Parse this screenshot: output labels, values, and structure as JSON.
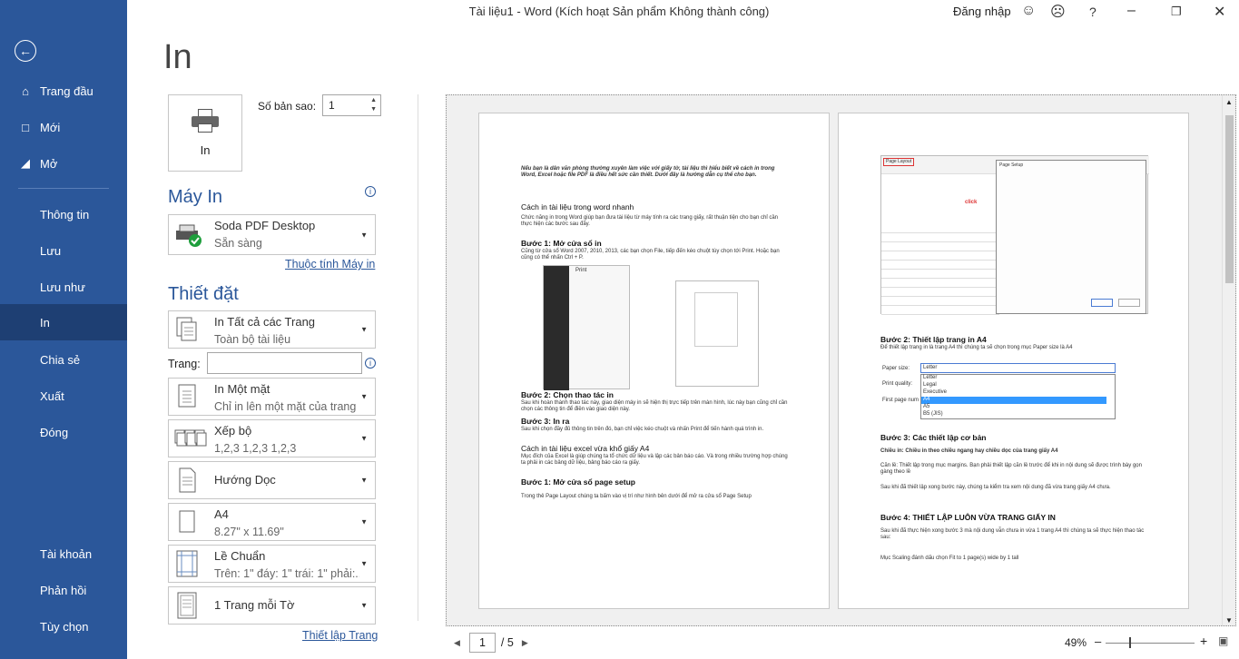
{
  "window": {
    "title": "Tài liệu1  -  Word (Kích hoạt Sản phẩm Không thành công)",
    "signin": "Đăng nhập"
  },
  "sidebar": {
    "items": [
      {
        "label": "Trang đầu",
        "icon": "home-icon"
      },
      {
        "label": "Mới",
        "icon": "new-document-icon"
      },
      {
        "label": "Mở",
        "icon": "folder-open-icon"
      },
      {
        "label": "Thông tin"
      },
      {
        "label": "Lưu"
      },
      {
        "label": "Lưu như"
      },
      {
        "label": "In",
        "active": true
      },
      {
        "label": "Chia sẻ"
      },
      {
        "label": "Xuất"
      },
      {
        "label": "Đóng"
      },
      {
        "label": "Tài khoản"
      },
      {
        "label": "Phản hồi"
      },
      {
        "label": "Tùy chọn"
      }
    ]
  },
  "main": {
    "heading": "In",
    "print_button": "In",
    "copies_label": "Số bản sao:",
    "copies_value": "1",
    "printer_section": "Máy In",
    "printer_name": "Soda PDF Desktop",
    "printer_status": "Sẵn sàng",
    "printer_properties": "Thuộc tính Máy in",
    "settings_section": "Thiết đặt",
    "settings": [
      {
        "l1": "In Tất cả các Trang",
        "l2": "Toàn bộ tài liệu"
      },
      {
        "l1": "In Một mặt",
        "l2": "Chỉ in lên một mặt của trang"
      },
      {
        "l1": "Xếp bộ",
        "l2": "1,2,3    1,2,3    1,2,3"
      },
      {
        "l1": "Hướng Dọc",
        "l2": ""
      },
      {
        "l1": "A4",
        "l2": "8.27\" x 11.69\""
      },
      {
        "l1": "Lề Chuẩn",
        "l2": "Trên: 1\" đáy: 1\" trái: 1\" phải:..."
      },
      {
        "l1": "1 Trang mỗi Tờ",
        "l2": ""
      }
    ],
    "pages_label": "Trang:",
    "page_setup_link": "Thiết lập Trang"
  },
  "preview": {
    "page1": {
      "intro": "Nếu bạn là dân văn phòng thường xuyên làm việc với giấy tờ, tài liệu thì hiểu biết về cách in trong Word, Excel  hoặc file PDF là điều hết sức cần thiết. Dưới đây là hướng dẫn cụ thể cho bạn.",
      "h1": "Cách in tài liệu trong word nhanh",
      "p1": "Chức năng in trong Word giúp bạn đưa tài liệu từ máy tính ra các trang giấy, rất thuận tiện cho bạn chỉ cần thực hiện các bước sau đây.",
      "b1": "Bước 1: Mở cửa sổ in",
      "p2": "Cũng từ cửa sổ Word 2007, 2010, 2013, các bạn chọn File, tiếp đến kéo chuột tùy chọn tới Print. Hoặc bạn cũng có thể nhấn Ctrl + P.",
      "b2": "Bước 2: Chọn thao tác in",
      "p3": "Sau khi hoàn thành thao tác này, giao diện máy in sẽ hiện thị trực tiếp trên màn hình, lúc này bạn cũng chỉ cần chọn các thông tin để điền vào giao diện này.",
      "b3": "Bước 3: In ra",
      "p4": "Sau khi chọn đầy đủ thông tin trên đó, bạn chỉ việc kéo chuột và nhấn Print để tiến hành quá trình in.",
      "h2": "Cách in tài liệu excel vừa khổ giấy A4",
      "p5": "Mục đích của Excel là giúp chúng ta tổ chức dữ liệu và lập các bản báo cáo. Và trong nhiều trường hợp chúng ta phải in các bảng dữ liệu, bảng báo cáo ra giấy.",
      "b4": "Bước 1: Mở cửa sổ page setup",
      "p6": "Trong thẻ Page Layout chúng ta bấm vào vị trí như hình bên dưới để mở ra cửa sổ Page Setup",
      "thumb_label": "Print"
    },
    "page2": {
      "b1": "Bước 2: Thiết lập trang in A4",
      "p1": "Để thiết lập trang in là trang A4 thì chúng ta sẽ chọn trong mục Paper size là A4",
      "paper_size_label": "Paper size:",
      "print_quality_label": "Print quality:",
      "first_page_label": "First page num",
      "paper_options": [
        "Letter",
        "Legal",
        "Executive",
        "A4",
        "A5",
        "B5 (JIS)"
      ],
      "paper_selected": "Letter",
      "b2": "Bước 3: Các thiết lập cơ bản",
      "p2": "Chiều in: Chiều in theo chiều ngang hay chiều dọc của trang giấy A4",
      "p3": "Căn lề: Thiết lập trong mục margins. Bạn phải thiết lập căn lề trước để khi in nội dung sẽ được trình bày gọn gàng theo lề",
      "p4": "Sau khi đã thiết lập xong bước này, chúng ta kiểm tra xem nội dung đã vừa trang giấy A4 chưa.",
      "b3": "Bước 4: THIẾT LẬP LUÔN VỪA TRANG GIẤY IN",
      "p5": "Sau khi đã thực hiện xong bước 3 mà nội dung vẫn chưa in vừa 1 trang A4 thì chúng ta sẽ thực hiện thao tác sau:",
      "p6": "Mục Scaling đánh dấu chọn Fit to 1 page(s) wide by 1 tall",
      "dialog_title": "Page Setup",
      "ribbon_tab": "Page Layout",
      "click_label": "click"
    }
  },
  "footer": {
    "current_page": "1",
    "total_pages": "/ 5",
    "zoom": "49%"
  }
}
